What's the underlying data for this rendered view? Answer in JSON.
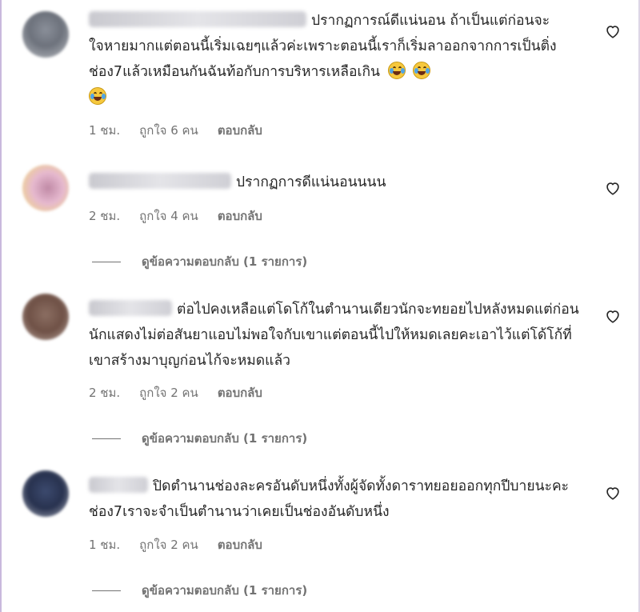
{
  "comments": [
    {
      "text": "ปรากฏการณ์ดีแน่นอน ถ้าเป็นแต่ก่อนจะใจหายมากแต่ตอนนี้เริ่มเฉยๆแล้วค่ะเพราะตอนนี้เราก็เริ่มลาออกจากการเป็นติ่งช่อง7แล้วเหมือนกันฉันท้อกับการบริหารเหลือเกิน",
      "emoji": "face-with-tears-of-joy",
      "time": "1 ชม.",
      "likes": "ถูกใจ 6 คน",
      "reply": "ตอบกลับ"
    },
    {
      "text": "ปรากฏการดีแน่นอนนนน",
      "time": "2 ชม.",
      "likes": "ถูกใจ 4 คน",
      "reply": "ตอบกลับ",
      "view_replies": "ดูข้อความตอบกลับ (1 รายการ)"
    },
    {
      "text": "ต่อไปคงเหลือแต่โดโก้ในตำนานเดียวนักจะทยอยไปหลังหมดแต่ก่อนนักแสดงไม่ต่อสันยาแอบไม่พอใจกับเขาแต่ตอนนี้ไปให้หมดเลยคะเอาไว้แต่โด้โก้ที่เขาสร้างมาบุญก่อนไก้จะหมดแล้ว",
      "time": "2 ชม.",
      "likes": "ถูกใจ 2 คน",
      "reply": "ตอบกลับ",
      "view_replies": "ดูข้อความตอบกลับ (1 รายการ)"
    },
    {
      "text": "ปิดตำนานช่องละครอันดับหนึ่งทั้งผู้จัดทั้งดาราทยอยออกทุกปีบายนะคะช่อง7เราจะจำเป็นตำนานว่าเคยเป็นช่องอันดับหนึ่ง",
      "time": "1 ชม.",
      "likes": "ถูกใจ 2 คน",
      "reply": "ตอบกลับ",
      "view_replies": "ดูข้อความตอบกลับ (1 รายการ)"
    }
  ],
  "colors": {
    "meta": "#737373",
    "text": "#262626"
  },
  "icons": {
    "like": "heart-outline-icon"
  }
}
